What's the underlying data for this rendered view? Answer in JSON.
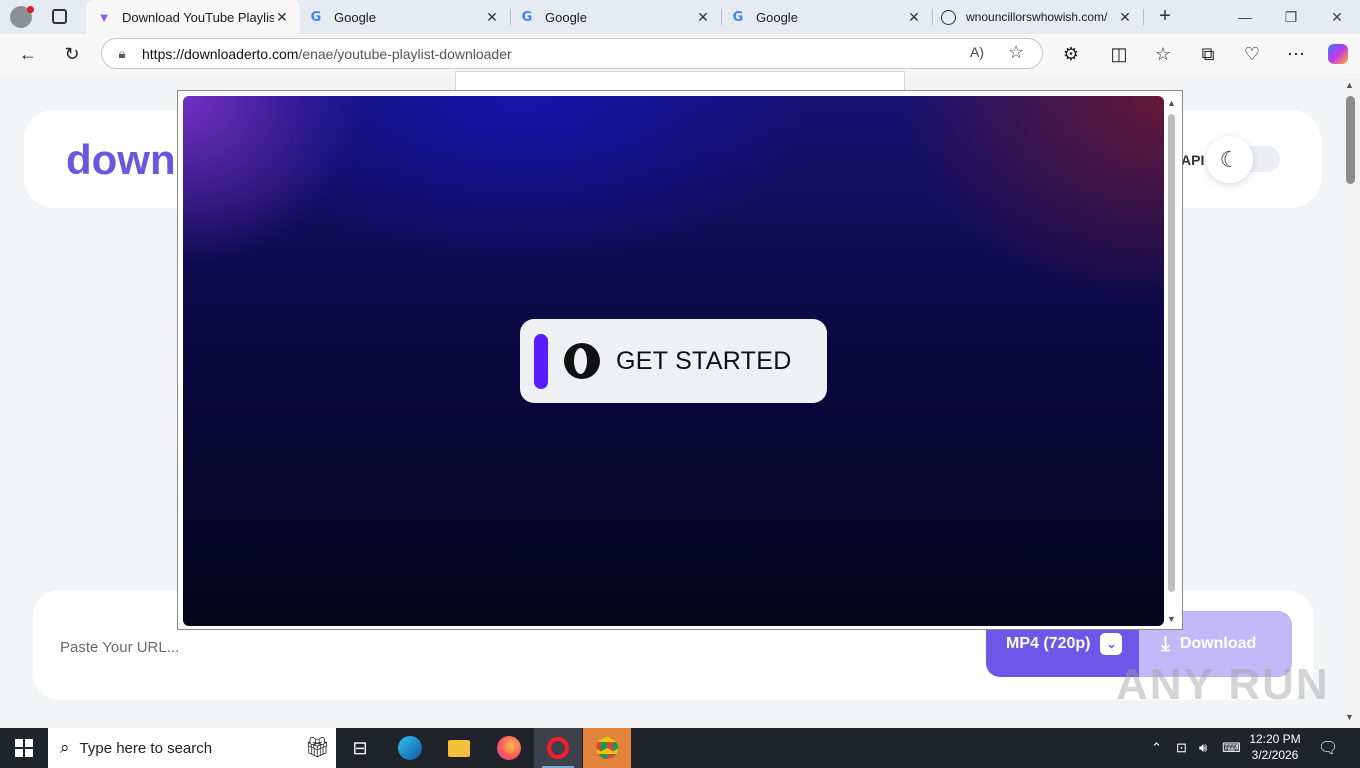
{
  "browser": {
    "tabs": [
      {
        "title": "Download YouTube Playlists",
        "icon": "v-logo-icon",
        "active": true
      },
      {
        "title": "Google",
        "icon": "google-icon",
        "active": false
      },
      {
        "title": "Google",
        "icon": "google-icon",
        "active": false
      },
      {
        "title": "Google",
        "icon": "google-icon",
        "active": false
      },
      {
        "title": "wnouncillorswhowish.com/",
        "icon": "globe-icon",
        "active": false
      }
    ],
    "url_host": "https://downloaderto.com",
    "url_path": "/enae/youtube-playlist-downloader"
  },
  "page": {
    "logo_text": "down",
    "api_label": "API",
    "url_placeholder": "Paste Your URL...",
    "format_label": "MP4 (720p)",
    "download_label": "Download"
  },
  "ad": {
    "cta_label": "GET STARTED"
  },
  "watermark": "ANY RUN",
  "taskbar": {
    "search_placeholder": "Type here to search",
    "time": "12:20 PM",
    "date": "3/2/2026"
  },
  "colors": {
    "brand": "#6c56e0",
    "format_button": "#6e56e8",
    "download_button": "#c3b8f8",
    "ad_accent": "#5a1dff"
  }
}
